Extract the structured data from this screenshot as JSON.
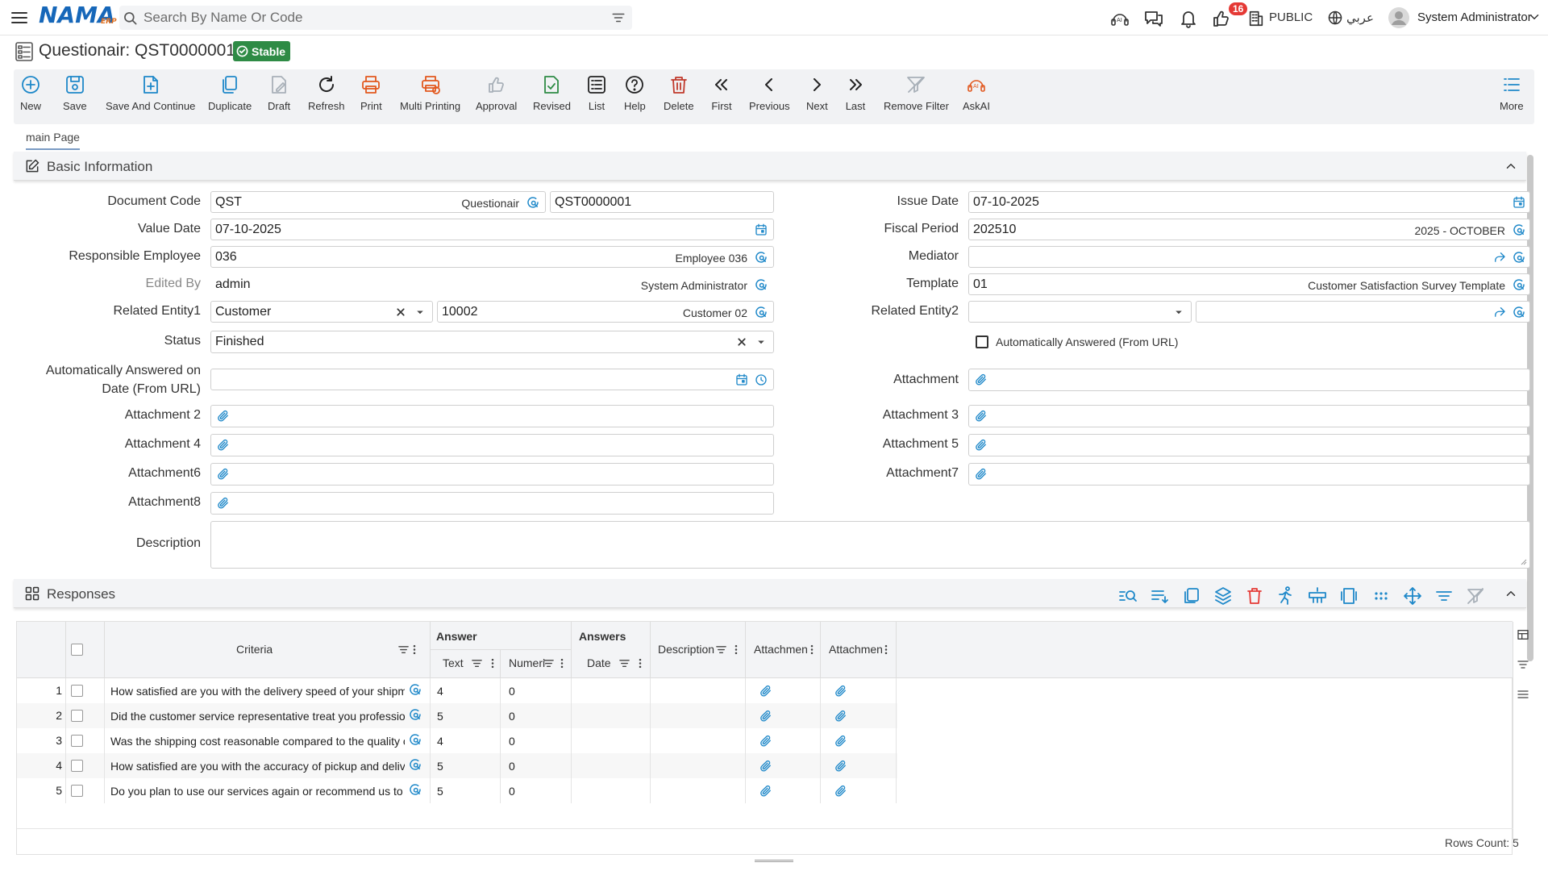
{
  "app": {
    "logo_text": "NAMA",
    "logo_sub": "ERP",
    "search_placeholder": "Search By Name Or Code",
    "notifications_count": "16",
    "branch_label": "PUBLIC",
    "language_label": "عربي",
    "user_name": "System Administrator"
  },
  "page": {
    "title": "Questionair: QST0000001",
    "status": "Stable"
  },
  "toolbar": [
    {
      "key": "new",
      "label": "New",
      "icon": "plus-circle-icon"
    },
    {
      "key": "save",
      "label": "Save",
      "icon": "save-icon"
    },
    {
      "key": "save-continue",
      "label": "Save And Continue",
      "icon": "save-continue-icon"
    },
    {
      "key": "duplicate",
      "label": "Duplicate",
      "icon": "duplicate-icon"
    },
    {
      "key": "draft",
      "label": "Draft",
      "icon": "draft-icon"
    },
    {
      "key": "refresh",
      "label": "Refresh",
      "icon": "refresh-icon"
    },
    {
      "key": "print",
      "label": "Print",
      "icon": "print-icon"
    },
    {
      "key": "multi-printing",
      "label": "Multi Printing",
      "icon": "multi-print-icon"
    },
    {
      "key": "approval",
      "label": "Approval",
      "icon": "thumbs-up-icon"
    },
    {
      "key": "revised",
      "label": "Revised",
      "icon": "revised-icon"
    },
    {
      "key": "list",
      "label": "List",
      "icon": "list-icon"
    },
    {
      "key": "help",
      "label": "Help",
      "icon": "help-icon"
    },
    {
      "key": "delete",
      "label": "Delete",
      "icon": "trash-icon"
    },
    {
      "key": "first",
      "label": "First",
      "icon": "double-chevron-left-icon"
    },
    {
      "key": "previous",
      "label": "Previous",
      "icon": "chevron-left-icon"
    },
    {
      "key": "next",
      "label": "Next",
      "icon": "chevron-right-icon"
    },
    {
      "key": "last",
      "label": "Last",
      "icon": "double-chevron-right-icon"
    },
    {
      "key": "remove-filter",
      "label": "Remove Filter",
      "icon": "remove-filter-icon"
    },
    {
      "key": "askai",
      "label": "AskAI",
      "icon": "ai-icon"
    },
    {
      "key": "more",
      "label": "More",
      "icon": "more-list-icon"
    }
  ],
  "tabs": [
    {
      "label": "main Page"
    }
  ],
  "basic_info": {
    "title": "Basic Information",
    "document_code": {
      "label": "Document Code",
      "value": "QST",
      "desc": "Questionair",
      "number": "QST0000001"
    },
    "value_date": {
      "label": "Value Date",
      "value": "07-10-2025"
    },
    "responsible_employee": {
      "label": "Responsible Employee",
      "value": "036",
      "desc": "Employee 036"
    },
    "edited_by": {
      "label": "Edited By",
      "value": "admin",
      "desc": "System Administrator"
    },
    "related_entity1": {
      "label": "Related Entity1",
      "value": "Customer",
      "code": "10002",
      "desc": "Customer 02"
    },
    "status": {
      "label": "Status",
      "value": "Finished"
    },
    "auto_answered_date": {
      "label": "Automatically Answered on Date (From URL)",
      "value": ""
    },
    "attachment2": {
      "label": "Attachment 2"
    },
    "attachment4": {
      "label": "Attachment 4"
    },
    "attachment6": {
      "label": "Attachment6"
    },
    "attachment8": {
      "label": "Attachment8"
    },
    "description": {
      "label": "Description",
      "value": ""
    },
    "issue_date": {
      "label": "Issue Date",
      "value": "07-10-2025"
    },
    "fiscal_period": {
      "label": "Fiscal Period",
      "value": "202510",
      "desc": "2025 - OCTOBER"
    },
    "mediator": {
      "label": "Mediator",
      "value": ""
    },
    "template": {
      "label": "Template",
      "value": "01",
      "desc": "Customer Satisfaction Survey Template"
    },
    "related_entity2": {
      "label": "Related Entity2",
      "value": "",
      "code": ""
    },
    "auto_answered": {
      "label": "Automatically Answered (From URL)",
      "checked": false
    },
    "attachment": {
      "label": "Attachment"
    },
    "attachment3": {
      "label": "Attachment 3"
    },
    "attachment5": {
      "label": "Attachment 5"
    },
    "attachment7": {
      "label": "Attachment7"
    }
  },
  "responses": {
    "title": "Responses",
    "group_answer": "Answer",
    "group_answers": "Answers",
    "columns": {
      "criteria": "Criteria",
      "text": "Text",
      "number": "Numeric",
      "date": "Date",
      "description": "Description",
      "attachment1": "Attachment",
      "attachment2": "Attachment"
    },
    "rows": [
      {
        "no": "1",
        "criteria": "How satisfied are you with the delivery speed of your shipment?",
        "text": "4",
        "number": "0"
      },
      {
        "no": "2",
        "criteria": "Did the customer service representative treat you professionally?",
        "text": "5",
        "number": "0"
      },
      {
        "no": "3",
        "criteria": "Was the shipping cost reasonable compared to the quality of service?",
        "text": "4",
        "number": "0"
      },
      {
        "no": "4",
        "criteria": "How satisfied are you with the accuracy of pickup and delivery times?",
        "text": "5",
        "number": "0"
      },
      {
        "no": "5",
        "criteria": "Do you plan to use our services again or recommend us to others?",
        "text": "5",
        "number": "0"
      }
    ],
    "rows_count": "Rows Count: 5"
  },
  "colors": {
    "accent": "#1e88c9",
    "status_green": "#2e8b45",
    "print_orange": "#e2581e",
    "delete_red": "#c0392b",
    "badge_red": "#e53935"
  }
}
